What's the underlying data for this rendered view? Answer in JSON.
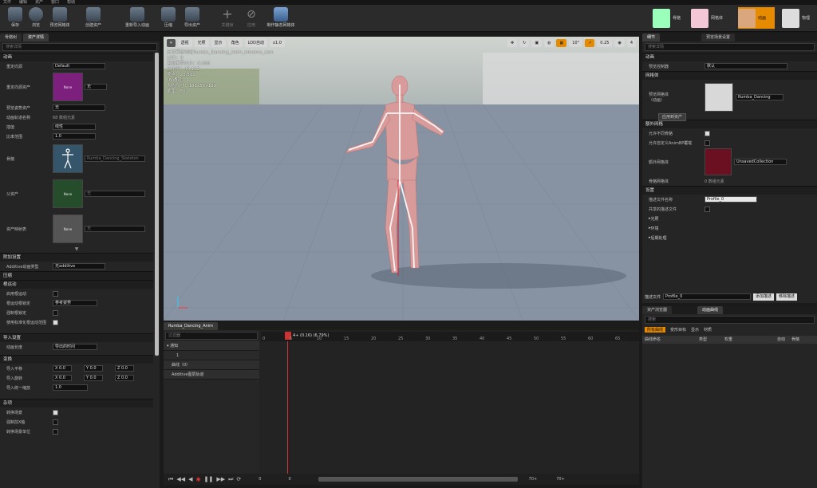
{
  "menu": [
    "文件",
    "编辑",
    "资产",
    "窗口",
    "帮助"
  ],
  "toolbar": {
    "buttons": [
      {
        "label": "保存",
        "icon": "save-icon"
      },
      {
        "label": "浏览",
        "icon": "browse-icon"
      },
      {
        "label": "预览网格体",
        "icon": "preview-mesh-icon"
      },
      {
        "label": "创建资产",
        "icon": "create-asset-icon"
      },
      {
        "label": "重新导入动画",
        "icon": "reimport-icon"
      },
      {
        "label": "压缩",
        "icon": "compress-icon"
      },
      {
        "label": "导出资产",
        "icon": "export-icon"
      },
      {
        "label": "关键帧",
        "icon": "key-icon"
      },
      {
        "label": "应用",
        "icon": "apply-icon"
      },
      {
        "label": "制作静态网格体",
        "icon": "make-static-mesh-icon"
      }
    ],
    "modes": [
      "骨骼",
      "网格体",
      "动画",
      "物理"
    ],
    "active_mode": "动画"
  },
  "left_tabs": [
    "骨骼树",
    "资产详情"
  ],
  "left_search_placeholder": "搜索详情",
  "left_sections": {
    "animation": "动画",
    "retarget_source_label": "重定向源",
    "retarget_source": "Default",
    "retarget_asset_label": "重定向源资产",
    "retarget_asset_value": "无",
    "preview_pose_label": "预览姿势资产",
    "preview_pose_value": "无",
    "track_names_label": "动画轨道名称",
    "track_names_value": "68 数组元素",
    "interp_label": "插值",
    "interp_value": "线性",
    "rate_label": "比率范围",
    "rate_value": "1.0",
    "skeleton_label": "骨骼",
    "skeleton_value": "Rumba_Dancing_Skeleton",
    "parent_label": "父资产",
    "parent_value": "无",
    "map_label": "资产映射表",
    "map_value": "无",
    "none_text": "None",
    "additive": "附加设置",
    "additive_type_label": "Additive动画类型",
    "additive_type": "无additive",
    "compression": "压缩",
    "root_motion": "根运动",
    "enable_root_motion": "启用根运动",
    "root_lock_label": "根运动根锁定",
    "root_lock": "参考姿势",
    "force_root_lock": "强制根锁定",
    "normalized_root": "使用标准化根运动范围",
    "import_settings": "导入设置",
    "anim_length_label": "动画长度",
    "anim_length": "导出的时间",
    "transform": "变换",
    "import_translation": "导入平移",
    "import_rotation": "导入旋转",
    "import_scale_label": "导入统一缩放",
    "import_scale": "1.0",
    "xyz": [
      "X 0.0",
      "Y 0.0",
      "Z 0.0"
    ],
    "misc": "杂项",
    "convert_scene": "转换场景",
    "force_front_x": "强制前X轴",
    "convert_units": "转换场景单位"
  },
  "viewport": {
    "buttons": [
      "透视",
      "光照",
      "显示",
      "角色",
      "LOD自动",
      "x1.0"
    ],
    "right_values": [
      "10°",
      "0.25",
      "4"
    ],
    "info": [
      "正在预览动画Rumba_Dancing_Anim_mixamo_com",
      "LOD：0",
      "当前屏幕大小：0.008",
      "三角形：49,112",
      "顶点：28,312",
      "UV通道：1",
      "大约尺寸：181x56x189",
      "帧率：30"
    ]
  },
  "timeline": {
    "tab": "Rumba_Dancing_Anim",
    "search_placeholder": "过滤器",
    "playhead_label": "4+ (0.16) (6.79%)",
    "ruler": [
      "0",
      "5",
      "10",
      "15",
      "20",
      "25",
      "30",
      "35",
      "40",
      "45",
      "50",
      "55",
      "60",
      "65",
      "70"
    ],
    "tracks": [
      "通知",
      "1",
      "曲线（0）",
      "Additive图层轨道"
    ],
    "bottom": [
      "0",
      "0",
      "70+",
      "70+"
    ]
  },
  "right_tabs": [
    "细节",
    "预览场景设置"
  ],
  "right_search_placeholder": "搜索详情",
  "right": {
    "animation": "动画",
    "preview_controller_label": "预览控制器",
    "preview_controller": "默认",
    "mesh": "网格体",
    "preview_mesh_label": "预览网格体\n（动画）",
    "preview_mesh": "Rumba_Dancing",
    "apply_button": "应用到资产",
    "extra_mesh": "额外网格",
    "allow_diff": "允许不同骨骼",
    "allow_custom": "允许自定义AnimBP覆载",
    "extra_mesh_label": "额外网格体",
    "extra_mesh_value": "UnsavedCollection",
    "skeletal_mesh_label": "骨骼网格体",
    "skeletal_mesh_value": "0 数组元素",
    "settings": "设置",
    "profile_name_label": "描述文件名称",
    "profile_name": "Profile_0",
    "shared_profile": "共享的描述文件",
    "light": "光照",
    "env": "环境",
    "post": "后期处理",
    "profile_label": "描述文件",
    "profile_value": "Profile_0",
    "add_profile": "添加描述",
    "remove_profile": "移除描述"
  },
  "curves": {
    "tabs": [
      "资产浏览器",
      "动画曲线"
    ],
    "search_placeholder": "搜索",
    "filters": [
      "所有曲线",
      "变形目标",
      "显示",
      "材质"
    ],
    "headers": [
      "曲线命名",
      "类型",
      "权重",
      "自动",
      "骨骼"
    ]
  },
  "colors": {
    "accent": "#e68a00",
    "viewport_floor": "#8793a3",
    "character": "#d99a9a"
  }
}
